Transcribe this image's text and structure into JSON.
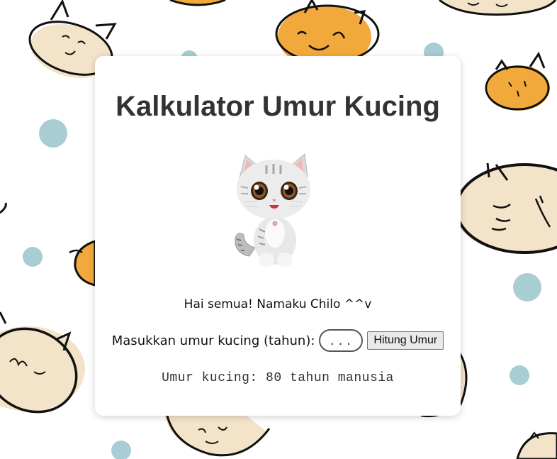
{
  "app": {
    "title": "Kalkulator Umur Kucing",
    "greeting": "Hai semua! Namaku Chilo ^^v",
    "cat_image": "chilo-kitten-illustration"
  },
  "form": {
    "label": "Masukkan umur kucing (tahun):",
    "input_value": "",
    "input_placeholder": "...",
    "button_label": "Hitung Umur"
  },
  "result": {
    "text": "Umur kucing: 80 tahun manusia"
  },
  "colors": {
    "card_bg": "#ffffff",
    "title": "#333333",
    "pattern_orange": "#F2A93B",
    "pattern_cream": "#F2E3C9",
    "pattern_blue_dot": "#A9CDD4",
    "pattern_outline": "#111111"
  }
}
